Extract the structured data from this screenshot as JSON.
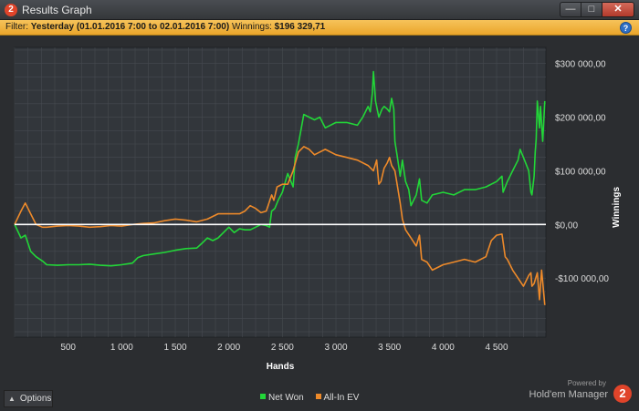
{
  "window": {
    "title": "Results Graph",
    "app_icon_glyph": "2",
    "buttons": {
      "minimize": "—",
      "maximize": "□",
      "close": "✕"
    }
  },
  "filter": {
    "label": "Filter:",
    "value": "Yesterday (01.01.2016 7:00 to 02.01.2016 7:00)",
    "winnings_label": "Winnings:",
    "winnings_value": "$196 329,71",
    "help_glyph": "?"
  },
  "footer": {
    "options_label": "Options",
    "powered_by": "Powered by",
    "brand": "Hold'em Manager",
    "brand_logo_glyph": "2"
  },
  "colors": {
    "plot_bg": "#32363b",
    "grid": "#464a50",
    "zero_line": "#ffffff",
    "net_won": "#22d638",
    "all_in_ev": "#ee8a2a"
  },
  "chart_data": {
    "type": "line",
    "title": "",
    "xlabel": "Hands",
    "ylabel": "Winnings",
    "xlim": [
      0,
      4960
    ],
    "ylim": [
      -210000,
      330000
    ],
    "x_ticks": [
      500,
      1000,
      1500,
      2000,
      2500,
      3000,
      3500,
      4000,
      4500
    ],
    "x_tick_labels": [
      "500",
      "1 000",
      "1 500",
      "2 000",
      "2 500",
      "3 000",
      "3 500",
      "4 000",
      "4 500"
    ],
    "y_ticks": [
      300000,
      200000,
      100000,
      0,
      -100000
    ],
    "y_tick_labels": [
      "$300 000,00",
      "$200 000,00",
      "$100 000,00",
      "$0,00",
      "-$100 000,00"
    ],
    "grid": true,
    "legend_position": "bottom-center",
    "series": [
      {
        "name": "Net Won",
        "color": "#22d638",
        "x": [
          0,
          60,
          100,
          150,
          200,
          260,
          300,
          400,
          500,
          600,
          700,
          800,
          900,
          1000,
          1100,
          1150,
          1200,
          1300,
          1400,
          1500,
          1600,
          1700,
          1750,
          1800,
          1850,
          1900,
          2000,
          2050,
          2100,
          2150,
          2200,
          2250,
          2300,
          2350,
          2380,
          2400,
          2430,
          2460,
          2500,
          2550,
          2600,
          2620,
          2650,
          2700,
          2750,
          2800,
          2850,
          2900,
          3000,
          3100,
          3200,
          3250,
          3300,
          3320,
          3340,
          3350,
          3370,
          3400,
          3430,
          3450,
          3480,
          3500,
          3520,
          3540,
          3550,
          3570,
          3600,
          3620,
          3650,
          3680,
          3700,
          3750,
          3780,
          3800,
          3850,
          3900,
          4000,
          4100,
          4200,
          4300,
          4400,
          4500,
          4550,
          4560,
          4600,
          4650,
          4700,
          4720,
          4750,
          4800,
          4820,
          4830,
          4850,
          4860,
          4870,
          4880,
          4900,
          4910,
          4930,
          4950
        ],
        "y": [
          0,
          -25000,
          -20000,
          -50000,
          -60000,
          -68000,
          -75000,
          -76000,
          -75000,
          -75000,
          -74000,
          -76000,
          -77000,
          -75000,
          -72000,
          -62000,
          -58000,
          -55000,
          -52000,
          -48000,
          -45000,
          -44000,
          -35000,
          -25000,
          -30000,
          -25000,
          -5000,
          -15000,
          -8000,
          -10000,
          -10000,
          -5000,
          0,
          -2000,
          -5000,
          25000,
          30000,
          45000,
          60000,
          95000,
          70000,
          125000,
          150000,
          205000,
          200000,
          195000,
          200000,
          180000,
          190000,
          190000,
          185000,
          200000,
          220000,
          210000,
          245000,
          285000,
          230000,
          200000,
          215000,
          220000,
          215000,
          210000,
          235000,
          215000,
          155000,
          130000,
          90000,
          120000,
          80000,
          65000,
          35000,
          55000,
          85000,
          45000,
          40000,
          55000,
          60000,
          55000,
          65000,
          65000,
          70000,
          80000,
          90000,
          60000,
          80000,
          100000,
          120000,
          140000,
          125000,
          100000,
          60000,
          55000,
          90000,
          135000,
          160000,
          230000,
          180000,
          220000,
          155000,
          230000
        ]
      },
      {
        "name": "All-In EV",
        "color": "#ee8a2a",
        "x": [
          0,
          60,
          100,
          150,
          200,
          260,
          300,
          400,
          500,
          600,
          700,
          800,
          900,
          1000,
          1100,
          1200,
          1300,
          1400,
          1500,
          1600,
          1700,
          1800,
          1850,
          1900,
          2000,
          2100,
          2150,
          2200,
          2250,
          2300,
          2350,
          2400,
          2420,
          2450,
          2500,
          2550,
          2600,
          2650,
          2700,
          2750,
          2800,
          2850,
          2900,
          3000,
          3100,
          3200,
          3300,
          3350,
          3380,
          3400,
          3420,
          3450,
          3480,
          3500,
          3520,
          3550,
          3600,
          3620,
          3650,
          3700,
          3750,
          3780,
          3800,
          3850,
          3900,
          4000,
          4100,
          4200,
          4300,
          4400,
          4450,
          4500,
          4550,
          4580,
          4600,
          4650,
          4700,
          4750,
          4800,
          4820,
          4830,
          4850,
          4880,
          4900,
          4920,
          4950
        ],
        "y": [
          0,
          25000,
          40000,
          20000,
          0,
          -5000,
          -5000,
          -3000,
          -2000,
          -3000,
          -5000,
          -4000,
          -2000,
          -3000,
          0,
          2000,
          3000,
          7000,
          10000,
          8000,
          5000,
          10000,
          15000,
          20000,
          20000,
          20000,
          25000,
          35000,
          30000,
          22000,
          25000,
          55000,
          45000,
          70000,
          75000,
          75000,
          100000,
          135000,
          145000,
          140000,
          130000,
          135000,
          140000,
          130000,
          125000,
          120000,
          110000,
          100000,
          120000,
          75000,
          80000,
          105000,
          115000,
          125000,
          110000,
          100000,
          40000,
          10000,
          -10000,
          -25000,
          -40000,
          -20000,
          -65000,
          -70000,
          -85000,
          -75000,
          -70000,
          -65000,
          -70000,
          -60000,
          -30000,
          -20000,
          -18000,
          -60000,
          -65000,
          -85000,
          -100000,
          -115000,
          -95000,
          -90000,
          -115000,
          -110000,
          -90000,
          -140000,
          -85000,
          -150000
        ]
      }
    ]
  }
}
